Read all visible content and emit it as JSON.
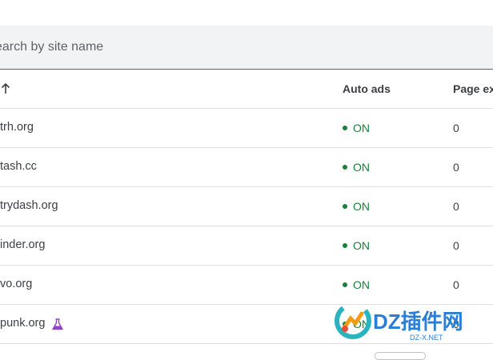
{
  "search": {
    "placeholder": "earch by site name"
  },
  "table": {
    "columns": {
      "auto_ads": "Auto ads",
      "page": "Page ex"
    },
    "rows": [
      {
        "site": "trh.org",
        "status": "ON",
        "views": "0"
      },
      {
        "site": "tash.cc",
        "status": "ON",
        "views": "0"
      },
      {
        "site": "trydash.org",
        "status": "ON",
        "views": "0"
      },
      {
        "site": "inder.org",
        "status": "ON",
        "views": "0"
      },
      {
        "site": "vo.org",
        "status": "ON",
        "views": "0"
      },
      {
        "site": "punk.org",
        "status": "ON",
        "views": "0",
        "badge_icon": "flask-icon"
      }
    ]
  },
  "watermark": {
    "text": "DZ插件网",
    "sub": "DZ-X.NET"
  },
  "colors": {
    "status_on": "#188038",
    "flask": "#8e44c7",
    "watermark": "#2a7fd4"
  }
}
